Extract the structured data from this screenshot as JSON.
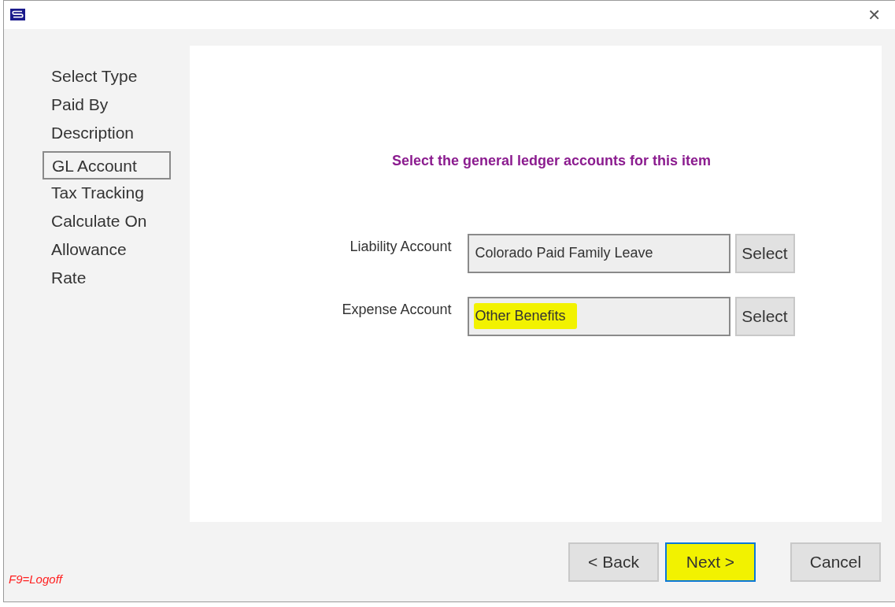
{
  "window": {
    "close_label": "✕"
  },
  "steps": [
    {
      "label": "Select Type",
      "selected": false
    },
    {
      "label": "Paid By",
      "selected": false
    },
    {
      "label": "Description",
      "selected": false
    },
    {
      "label": "GL Account",
      "selected": true
    },
    {
      "label": "Tax Tracking",
      "selected": false
    },
    {
      "label": "Calculate On",
      "selected": false
    },
    {
      "label": "Allowance",
      "selected": false
    },
    {
      "label": "Rate",
      "selected": false
    }
  ],
  "heading": "Select the general ledger accounts for this item",
  "accounts": [
    {
      "label": "Liability Account",
      "value": "Colorado Paid Family Leave",
      "button": "Select",
      "highlighted": false
    },
    {
      "label": "Expense Account",
      "value": "Other Benefits",
      "button": "Select",
      "highlighted": true
    }
  ],
  "hotkey": "F9=Logoff",
  "buttons": [
    {
      "label": "< Back",
      "highlighted": false,
      "focused": false
    },
    {
      "label": "Next >",
      "highlighted": true,
      "focused": true
    },
    {
      "label": "Cancel",
      "highlighted": false,
      "focused": false
    }
  ]
}
